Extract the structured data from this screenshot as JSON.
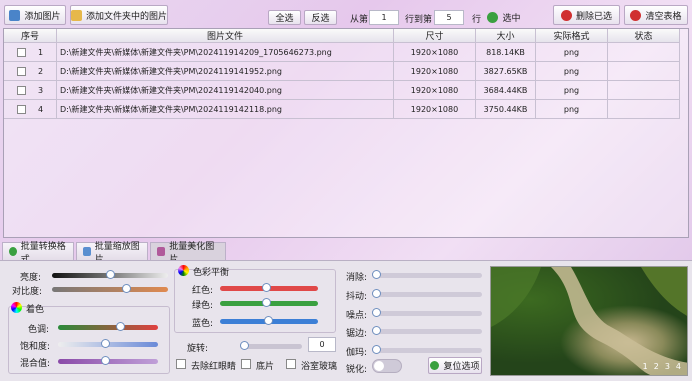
{
  "toolbar": {
    "add_image": "添加图片",
    "add_folder": "添加文件夹中的图片",
    "select_all": "全选",
    "invert": "反选",
    "from_label": "从第",
    "from_value": "1",
    "to_label": "行到第",
    "to_value": "5",
    "row_label": "行",
    "select_btn": "选中",
    "delete_selected": "删除已选",
    "clear_table": "清空表格"
  },
  "table": {
    "headers": [
      "序号",
      "图片文件",
      "尺寸",
      "大小",
      "实际格式",
      "状态"
    ],
    "rows": [
      {
        "index": "1",
        "file": "D:\\新建文件夹\\新媒体\\新建文件夹\\PM\\202411914209_1705646273.png",
        "size": "1920×1080",
        "bytes": "818.14KB",
        "format": "png",
        "status": ""
      },
      {
        "index": "2",
        "file": "D:\\新建文件夹\\新媒体\\新建文件夹\\PM\\2024119141952.png",
        "size": "1920×1080",
        "bytes": "3827.65KB",
        "format": "png",
        "status": ""
      },
      {
        "index": "3",
        "file": "D:\\新建文件夹\\新媒体\\新建文件夹\\PM\\2024119142040.png",
        "size": "1920×1080",
        "bytes": "3684.44KB",
        "format": "png",
        "status": ""
      },
      {
        "index": "4",
        "file": "D:\\新建文件夹\\新媒体\\新建文件夹\\PM\\2024119142118.png",
        "size": "1920×1080",
        "bytes": "3750.44KB",
        "format": "png",
        "status": ""
      }
    ]
  },
  "tabs": [
    "批量转换格式",
    "批量缩放图片",
    "批量美化图片"
  ],
  "adjust": {
    "brightness": "亮度:",
    "contrast": "对比度:",
    "color_section": "着色",
    "hue": "色调:",
    "saturation": "饱和度:",
    "mix": "混合值:",
    "balance_section": "色彩平衡",
    "red": "红色:",
    "green": "绿色:",
    "blue": "蓝色:",
    "rotate": "旋转:",
    "rotate_value": "0",
    "remove_redeye": "去除红眼睛",
    "negative": "底片",
    "bathroom_glass": "浴室玻璃",
    "blur": "消除:",
    "shake": "抖动:",
    "noise": "噪点:",
    "edge": "锯边:",
    "gamma": "伽玛:",
    "sharpen": "锐化:",
    "reset": "复位选项"
  },
  "preview": {
    "pages": [
      "1",
      "2",
      "3",
      "4"
    ]
  },
  "colors": {
    "accent_blue": "#3c7fd6",
    "danger_red": "#d03030",
    "ok_green": "#3aa040"
  }
}
